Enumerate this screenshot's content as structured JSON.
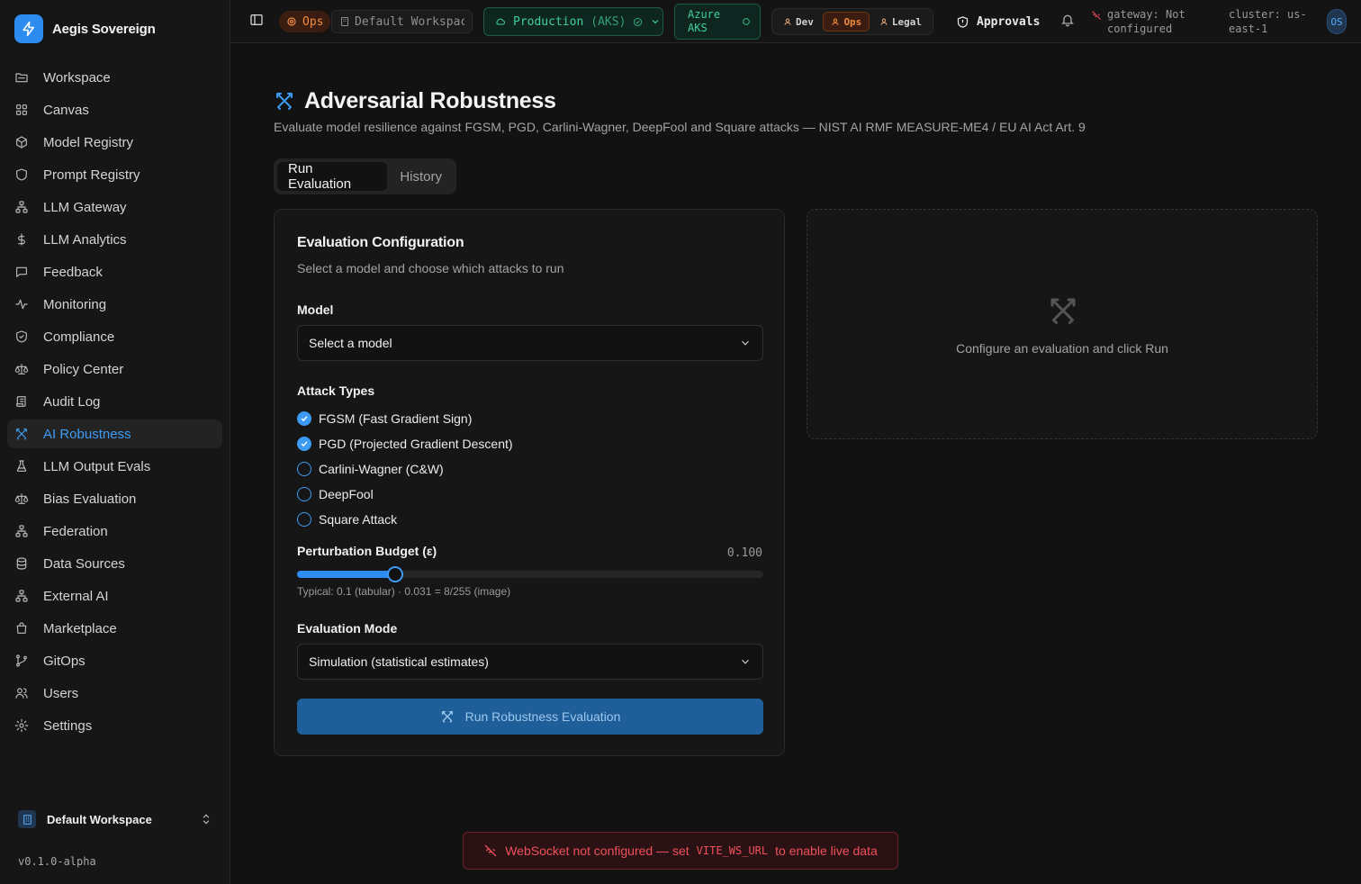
{
  "app": {
    "name": "Aegis Sovereign",
    "version": "v0.1.0-alpha"
  },
  "sidebar": {
    "items": [
      {
        "label": "Workspace",
        "icon": "folder-icon"
      },
      {
        "label": "Canvas",
        "icon": "grid-icon"
      },
      {
        "label": "Model Registry",
        "icon": "cube-icon"
      },
      {
        "label": "Prompt Registry",
        "icon": "shield-icon"
      },
      {
        "label": "LLM Gateway",
        "icon": "network-icon"
      },
      {
        "label": "LLM Analytics",
        "icon": "dollar-icon"
      },
      {
        "label": "Feedback",
        "icon": "message-icon"
      },
      {
        "label": "Monitoring",
        "icon": "activity-icon"
      },
      {
        "label": "Compliance",
        "icon": "shield-check-icon"
      },
      {
        "label": "Policy Center",
        "icon": "scale-icon"
      },
      {
        "label": "Audit Log",
        "icon": "scroll-icon"
      },
      {
        "label": "AI Robustness",
        "icon": "swords-icon",
        "active": true
      },
      {
        "label": "LLM Output Evals",
        "icon": "flask-icon"
      },
      {
        "label": "Bias Evaluation",
        "icon": "scale-icon"
      },
      {
        "label": "Federation",
        "icon": "network-icon"
      },
      {
        "label": "Data Sources",
        "icon": "database-icon"
      },
      {
        "label": "External AI",
        "icon": "network-icon"
      },
      {
        "label": "Marketplace",
        "icon": "bag-icon"
      },
      {
        "label": "GitOps",
        "icon": "git-branch-icon"
      },
      {
        "label": "Users",
        "icon": "users-icon"
      },
      {
        "label": "Settings",
        "icon": "gear-icon"
      }
    ],
    "workspace": "Default Workspace"
  },
  "topbar": {
    "persona_badge": "Ops",
    "workspace": "Default Workspace",
    "environment": "Production",
    "environment_cluster": "(AKS)",
    "cloud_line1": "Azure",
    "cloud_line2": "AKS",
    "personas": [
      "Dev",
      "Ops",
      "Legal"
    ],
    "active_persona": "Ops",
    "approvals": "Approvals",
    "gateway_line1": "gateway: Not",
    "gateway_line2": "configured",
    "cluster_line1": "cluster: us-",
    "cluster_line2": "east-1",
    "avatar": "OS"
  },
  "page": {
    "title": "Adversarial Robustness",
    "subtitle": "Evaluate model resilience against FGSM, PGD, Carlini-Wagner, DeepFool and Square attacks — NIST AI RMF MEASURE-ME4 / EU AI Act Art. 9",
    "tabs": [
      "Run Evaluation",
      "History"
    ],
    "active_tab": "Run Evaluation"
  },
  "config": {
    "title": "Evaluation Configuration",
    "subtitle": "Select a model and choose which attacks to run",
    "model_label": "Model",
    "model_value": "Select a model",
    "attack_label": "Attack Types",
    "attacks": [
      {
        "label": "FGSM (Fast Gradient Sign)",
        "checked": true
      },
      {
        "label": "PGD (Projected Gradient Descent)",
        "checked": true
      },
      {
        "label": "Carlini-Wagner (C&W)",
        "checked": false
      },
      {
        "label": "DeepFool",
        "checked": false
      },
      {
        "label": "Square Attack",
        "checked": false
      }
    ],
    "epsilon_label": "Perturbation Budget (ε)",
    "epsilon_value": "0.100",
    "epsilon_fraction": 0.21,
    "epsilon_hint": "Typical: 0.1 (tabular) · 0.031 = 8/255 (image)",
    "mode_label": "Evaluation Mode",
    "mode_value": "Simulation (statistical estimates)",
    "run_label": "Run Robustness Evaluation"
  },
  "results": {
    "empty_text": "Configure an evaluation and click Run"
  },
  "banner": {
    "prefix": "WebSocket not configured — set",
    "code": "VITE_WS_URL",
    "suffix": "to enable live data"
  },
  "colors": {
    "accent": "#3d9bf5",
    "ops": "#f08a3c",
    "env": "#3fcf9a",
    "error": "#f0505a"
  }
}
